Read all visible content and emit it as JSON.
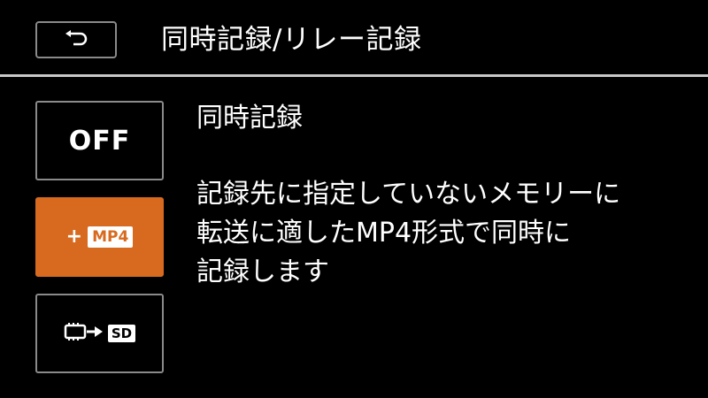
{
  "header": {
    "back_icon": "return-arrow-icon",
    "title": "同時記録/リレー記録"
  },
  "options": [
    {
      "id": "off",
      "label": "OFF",
      "selected": false
    },
    {
      "id": "mp4",
      "prefix": "+",
      "badge": "MP4",
      "selected": true
    },
    {
      "id": "relay",
      "icon": "memory-to-sd-relay-icon",
      "badge": "SD",
      "selected": false
    }
  ],
  "description": {
    "title": "同時記録",
    "lines": [
      "記録先に指定していないメモリーに",
      "転送に適したMP4形式で同時に",
      "記録します"
    ]
  },
  "colors": {
    "background": "#000000",
    "selected": "#d76a1f",
    "border": "#8a8a8a",
    "text": "#ffffff"
  }
}
